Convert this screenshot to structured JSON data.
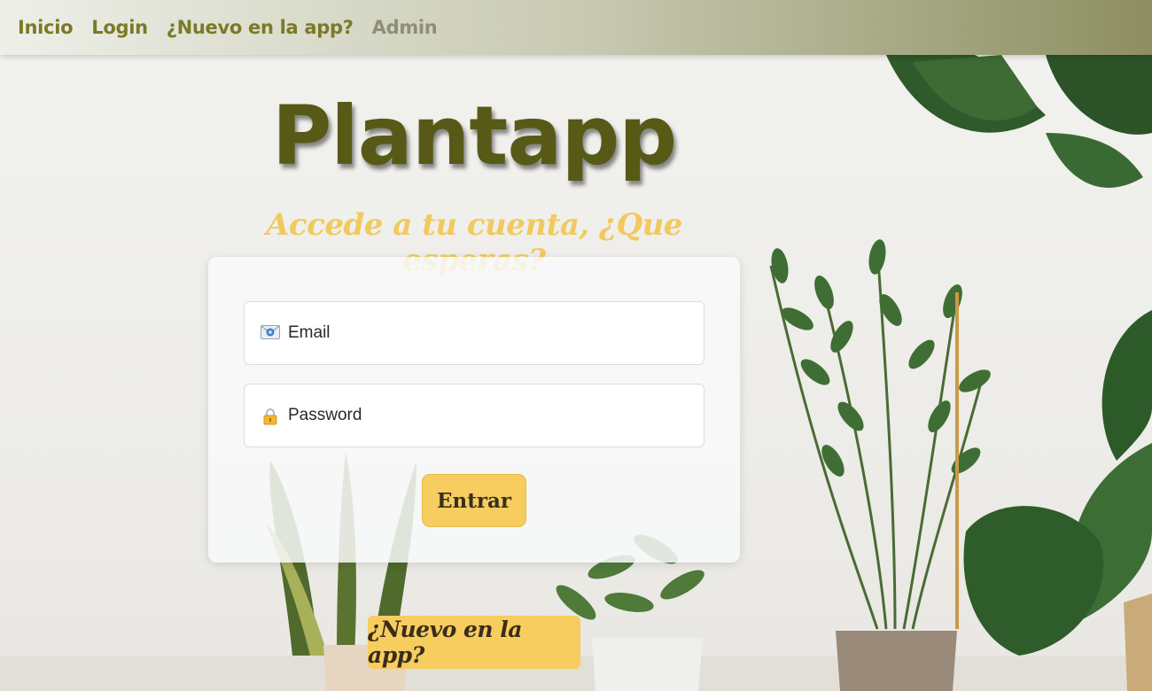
{
  "nav": {
    "items": [
      {
        "label": "Inicio",
        "disabled": false
      },
      {
        "label": "Login",
        "disabled": false
      },
      {
        "label": "¿Nuevo en la app?",
        "disabled": false
      },
      {
        "label": "Admin",
        "disabled": true
      }
    ]
  },
  "hero": {
    "title": "Plantapp",
    "subtitle": "Accede a tu cuenta, ¿Que esperas?"
  },
  "login_form": {
    "email_label": "Email",
    "email_icon": "envelope-icon",
    "password_label": "Password",
    "password_icon": "lock-icon",
    "submit_label": "Entrar"
  },
  "signup_cta": {
    "label": "¿Nuevo en la app?"
  },
  "colors": {
    "brand_olive": "#575a17",
    "accent_yellow": "#f6cd5e",
    "subtitle_yellow": "#f2c95e",
    "nav_text": "#7b7a25"
  }
}
